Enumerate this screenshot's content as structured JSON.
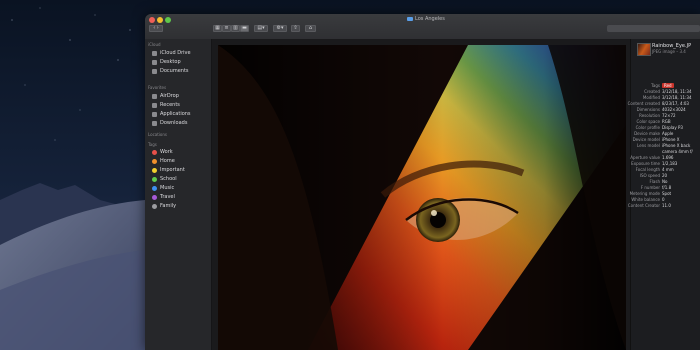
{
  "window": {
    "title": "Los Angeles"
  },
  "sidebar": {
    "icloud_header": "iCloud",
    "icloud_items": [
      {
        "label": "iCloud Drive",
        "icon": "cloud-icon"
      },
      {
        "label": "Desktop",
        "icon": "desktop-icon"
      },
      {
        "label": "Documents",
        "icon": "document-icon"
      }
    ],
    "favorites_header": "Favorites",
    "favorites_items": [
      {
        "label": "AirDrop",
        "icon": "airdrop-icon"
      },
      {
        "label": "Recents",
        "icon": "clock-icon"
      },
      {
        "label": "Applications",
        "icon": "applications-icon"
      },
      {
        "label": "Downloads",
        "icon": "download-icon"
      }
    ],
    "locations_header": "Locations",
    "tags_header": "Tags",
    "tags": [
      {
        "label": "Work",
        "color": "#e8504a"
      },
      {
        "label": "Home",
        "color": "#f0902c"
      },
      {
        "label": "Important",
        "color": "#f2cf2e"
      },
      {
        "label": "School",
        "color": "#5fcb4c"
      },
      {
        "label": "Music",
        "color": "#3e8ef0"
      },
      {
        "label": "Travel",
        "color": "#a75ad6"
      },
      {
        "label": "Family",
        "color": "#9b9ba0"
      }
    ]
  },
  "inspector": {
    "file_name": "Rainbow_Eye.JP",
    "file_sub": "JPEG image – 3.4",
    "rows": [
      {
        "k": "Tags",
        "v": "Red",
        "tag": true
      },
      {
        "k": "Created",
        "v": "3/12/18, 11:34"
      },
      {
        "k": "Modified",
        "v": "3/12/18, 11:34"
      },
      {
        "k": "Content created",
        "v": "8/23/17, 4:03"
      },
      {
        "k": "Dimensions",
        "v": "4032×3024"
      },
      {
        "k": "Resolution",
        "v": "72×72"
      },
      {
        "k": "Color space",
        "v": "RGB"
      },
      {
        "k": "Color profile",
        "v": "Display P3"
      },
      {
        "k": "Device make",
        "v": "Apple"
      },
      {
        "k": "Device model",
        "v": "iPhone X"
      },
      {
        "k": "Lens model",
        "v": "iPhone X back"
      },
      {
        "k": "",
        "v": "camera 4mm f/"
      },
      {
        "k": "Aperture value",
        "v": "1.696"
      },
      {
        "k": "Exposure time",
        "v": "1/2,183"
      },
      {
        "k": "Focal length",
        "v": "4 mm"
      },
      {
        "k": "ISO speed",
        "v": "20"
      },
      {
        "k": "Flash",
        "v": "No"
      },
      {
        "k": "F number",
        "v": "f/1.8"
      },
      {
        "k": "Metering mode",
        "v": "Spot"
      },
      {
        "k": "White balance",
        "v": "0"
      },
      {
        "k": "Content Creator",
        "v": "11.0"
      }
    ]
  }
}
